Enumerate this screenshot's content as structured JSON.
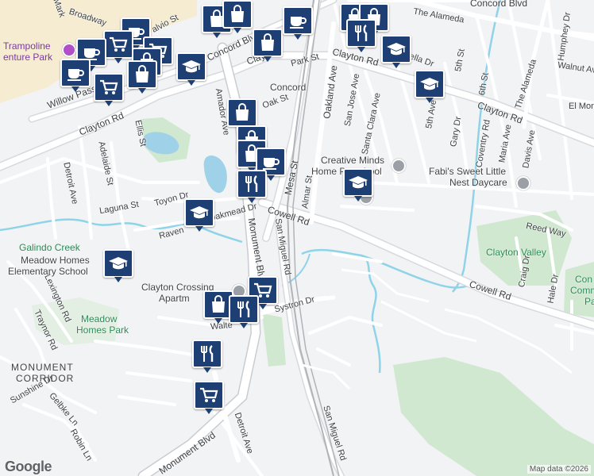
{
  "map": {
    "logo": "Google",
    "attribution": "Map data ©2026"
  },
  "labels": {
    "trampoline": "Trampoline",
    "trampoline2": "enture Park",
    "concord_town": "Concord",
    "monument_corridor_1": "MONUMENT",
    "monument_corridor_2": "CORRIDOR",
    "meadow_homes_park_1": "Meadow",
    "meadow_homes_park_2": "Homes Park",
    "meadow_homes_school_1": "Meadow Homes",
    "meadow_homes_school_2": "Elementary School",
    "galindo_creek": "Galindo Creek",
    "clayton_crossing_1": "Clayton Crossing",
    "clayton_crossing_2": "Apartm",
    "creative_minds_1": "Creative Minds",
    "creative_minds_2": "Home Preschool",
    "fabis_1": "Fabi's Sweet Little",
    "fabis_2": "Nest Daycare",
    "clayton_valley": "Clayton Valley",
    "com_1": "Con",
    "com_2": "Comm",
    "com_3": "Pa"
  },
  "roads": {
    "clayton_rd_ne": "Clayton Rd",
    "clayton_rd_e": "Clayton Rd",
    "clayton_rd_w": "Clayton Rd",
    "clayton_rd_top": "Clayto",
    "concord_blvd": "Concord Blvd",
    "concord_blvd_top": "Concord Blvd",
    "willow_pass": "Willow Pass",
    "cowell_rd": "Cowell Rd",
    "cowell_rd_e": "Cowell Rd",
    "mesa_st": "Mesa St",
    "monument_blvd": "Monument Blvd",
    "monument_blvd_s": "Monument Blvd",
    "san_miguel": "San Miguel Rd",
    "san_miguel_s": "San Miguel Rd",
    "almar_st": "Almar St",
    "oakland_ave": "Oakland Ave",
    "san_jose_ave": "San Jose Ave",
    "santa_clara": "Santa Clara Ave",
    "park_st": "Park St",
    "oak_st": "Oak St",
    "amador": "Amador Ave",
    "ellis_st": "Ellis St",
    "adelaide": "Adelaide St",
    "detroit_ave": "Detroit Ave",
    "detroit_ave_s": "Detroit Ave",
    "laguna_st": "Laguna St",
    "toyon": "Toyon Dr",
    "oakmead": "Oakmead Dr",
    "raven": "Raven",
    "walter": "Walte",
    "systron": "Systron Dr",
    "lexington": "Lexington Rd",
    "traynor": "Traynor Rd",
    "sunshine": "Sunshine Dr",
    "gelbke": "Gelbke Ln",
    "robin": "Robin Ln",
    "the_alameda": "The Alameda",
    "the_alameda_2": "The Alameda",
    "humphrey": "Humphey Dr",
    "walnut": "Walnut Ave",
    "fifth_st": "5th St",
    "fifth_ave": "5th Ave",
    "sixth_st": "6th St",
    "gary": "Gary Dr",
    "coventry": "Coventry Rd",
    "maria": "Maria Ave",
    "davis": "Davis Ave",
    "reed_way": "Reed Way",
    "craig": "Craig Dr",
    "hale": "Hale Dr",
    "el_mon": "El Mon",
    "broadway": "Broadway",
    "salvio": "alvio St",
    "mark": "Mark",
    "bella": "ella Dr"
  }
}
